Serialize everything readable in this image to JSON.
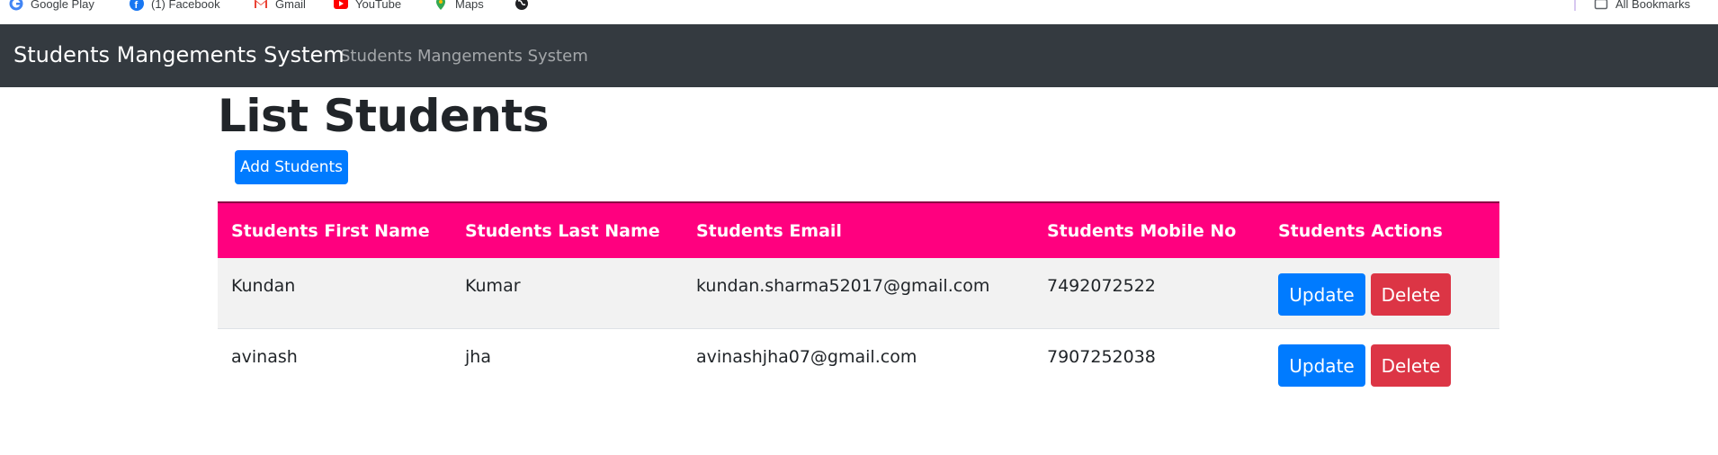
{
  "bookmarks": [
    {
      "label": "Google Play",
      "icon": "google-icon"
    },
    {
      "label": "(1) Facebook",
      "icon": "facebook-icon"
    },
    {
      "label": "Gmail",
      "icon": "gmail-icon"
    },
    {
      "label": "YouTube",
      "icon": "youtube-icon"
    },
    {
      "label": "Maps",
      "icon": "maps-icon"
    },
    {
      "label": "",
      "icon": "globe-icon"
    }
  ],
  "all_bookmarks": {
    "label": "All Bookmarks",
    "icon": "folder-icon"
  },
  "navbar": {
    "brand": "Students Mangements System",
    "link": "Students Mangements System"
  },
  "page": {
    "title": "List Students",
    "add_button": "Add Students"
  },
  "table": {
    "headers": [
      "Students First Name",
      "Students Last Name",
      "Students Email",
      "Students Mobile No",
      "Students Actions"
    ],
    "rows": [
      {
        "first": "Kundan",
        "last": "Kumar",
        "email": "kundan.sharma52017@gmail.com",
        "mobile": "7492072522",
        "update": "Update",
        "delete": "Delete"
      },
      {
        "first": "avinash",
        "last": "jha",
        "email": "avinashjha07@gmail.com",
        "mobile": "7907252038",
        "update": "Update",
        "delete": "Delete"
      }
    ]
  },
  "colors": {
    "navbar": "#343a40",
    "header": "#ff007f",
    "primary": "#007bff",
    "danger": "#dc3545"
  }
}
